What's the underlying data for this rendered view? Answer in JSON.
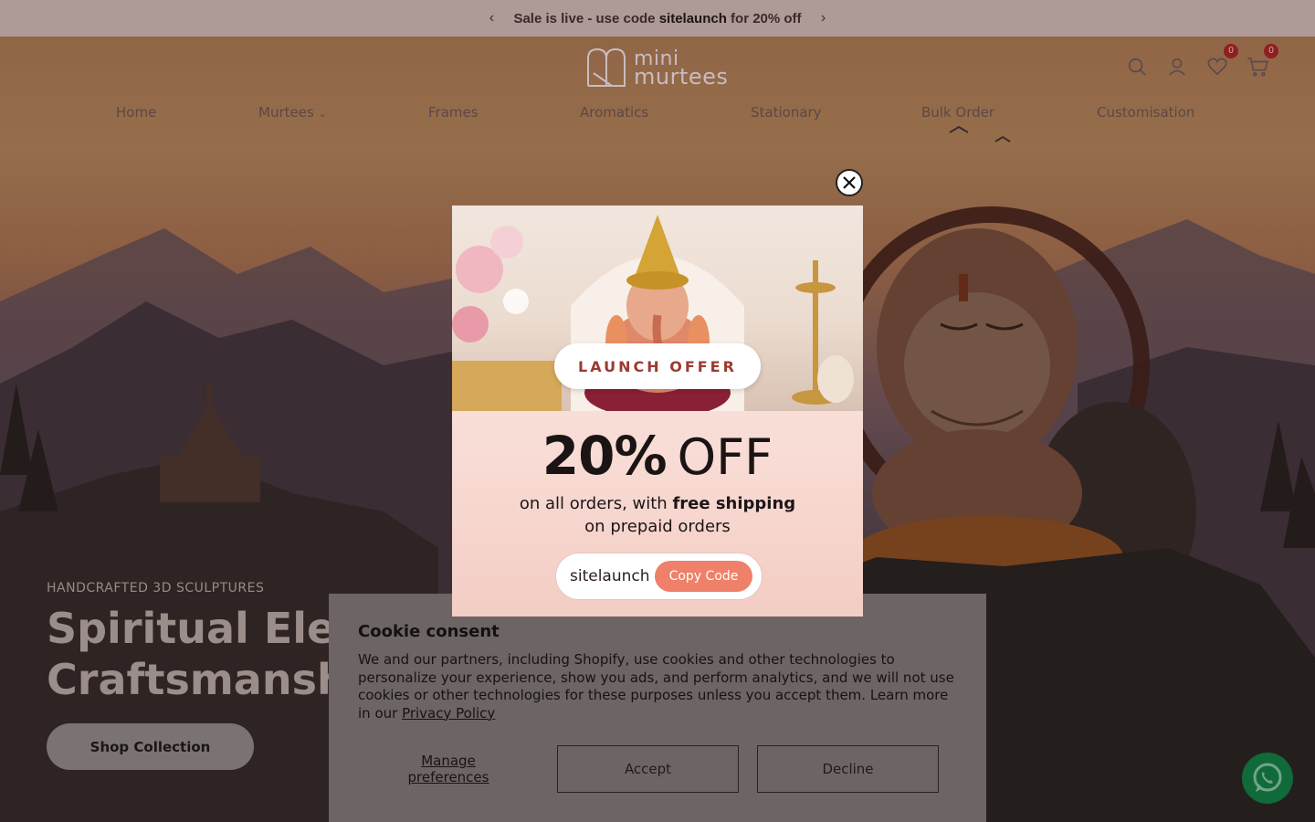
{
  "announcement": {
    "prefix": "Sale is live - use code ",
    "code": "sitelaunch",
    "suffix": " for 20% off"
  },
  "brand": {
    "line1": "mini",
    "line2": "murtees"
  },
  "header": {
    "wishlist_count": "0",
    "cart_count": "0"
  },
  "nav": {
    "items": [
      "Home",
      "Murtees",
      "Frames",
      "Aromatics",
      "Stationary",
      "Bulk Order",
      "Customisation"
    ]
  },
  "hero": {
    "eyebrow": "HANDCRAFTED 3D SCULPTURES",
    "title_line1": "Spiritual Eleg",
    "title_line2": "Craftsmanshi",
    "cta": "Shop Collection"
  },
  "popup": {
    "badge": "LAUNCH OFFER",
    "percent": "20%",
    "off": "OFF",
    "sub1_prefix": "on all orders, with ",
    "sub1_bold": "free shipping",
    "sub2": "on prepaid orders",
    "code": "sitelaunch",
    "copy_label": "Copy Code"
  },
  "cookie": {
    "title": "Cookie consent",
    "body": "We and our partners, including Shopify, use cookies and other technologies to personalize your experience, show you ads, and perform analytics, and we will not use cookies or other technologies for these purposes unless you accept them. Learn more in our ",
    "link": "Privacy Policy",
    "manage": "Manage preferences",
    "accept": "Accept",
    "decline": "Decline"
  },
  "colors": {
    "announcement_bg": "#ae9a96",
    "accent_copy": "#ef8069",
    "whatsapp": "#116a39",
    "badge": "#8e1f1f"
  }
}
